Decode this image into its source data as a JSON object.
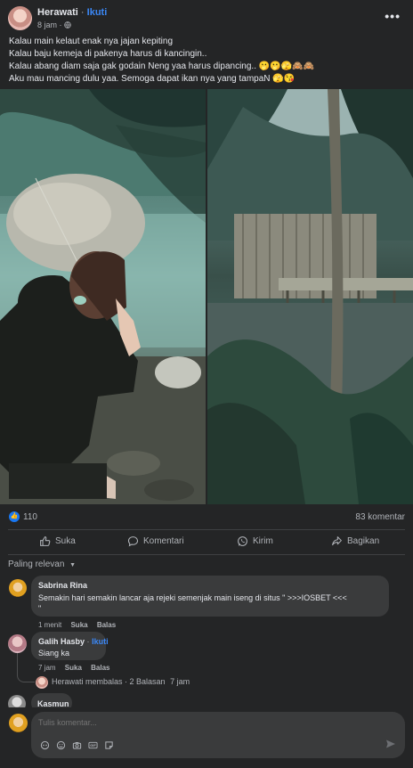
{
  "post": {
    "author": "Herawati",
    "separator": "·",
    "follow_label": "Ikuti",
    "time": "8 jam",
    "privacy_icon": "globe-icon",
    "more_label": "•••",
    "lines": [
      "Kalau main kelaut enak nya jajan kepiting",
      "Kalau baju kemeja di pakenya harus di kancingin..",
      "Kalau abang diam saja gak godain Neng yaa harus dipancing.. 🫢🫢🫣🙈🙈",
      "Aku mau mancing dulu yaa. Semoga dapat ikan nya yang tampaN 🫣😘"
    ]
  },
  "stats": {
    "reaction_icon": "like-icon",
    "reaction_count": "110",
    "comments": "83 komentar"
  },
  "actions": {
    "like": "Suka",
    "comment": "Komentari",
    "send": "Kirim",
    "share": "Bagikan"
  },
  "sort": {
    "label": "Paling relevan",
    "arrow": "▼"
  },
  "comments": [
    {
      "name": "Sabrina Rina",
      "text_line1": "Semakin hari semakin lancar aja rejeki semenjak main iseng di situs \" >>>IOSBET <<<",
      "text_line2": "\"",
      "time": "1 menit",
      "like": "Suka",
      "reply": "Balas"
    },
    {
      "name": "Galih Hasby",
      "separator": "·",
      "follow_label": "Ikuti",
      "text": "Siang ka",
      "time": "7 jam",
      "like": "Suka",
      "reply": "Balas",
      "reply_summary": "Herawati membalas · 2 Balasan",
      "reply_time": "7 jam"
    },
    {
      "name": "Kasmun"
    }
  ],
  "composer": {
    "placeholder": "Tulis komentar...",
    "tools": [
      "avatar-sticker-icon",
      "emoji-icon",
      "camera-icon",
      "gif-icon",
      "sticker-icon"
    ],
    "gif_label": "GIF"
  },
  "colors": {
    "background": "#242526",
    "bubble": "#3a3b3c",
    "accent": "#3b87f5",
    "like_blue": "#1877f2",
    "secondary_text": "#b0b3b8"
  }
}
